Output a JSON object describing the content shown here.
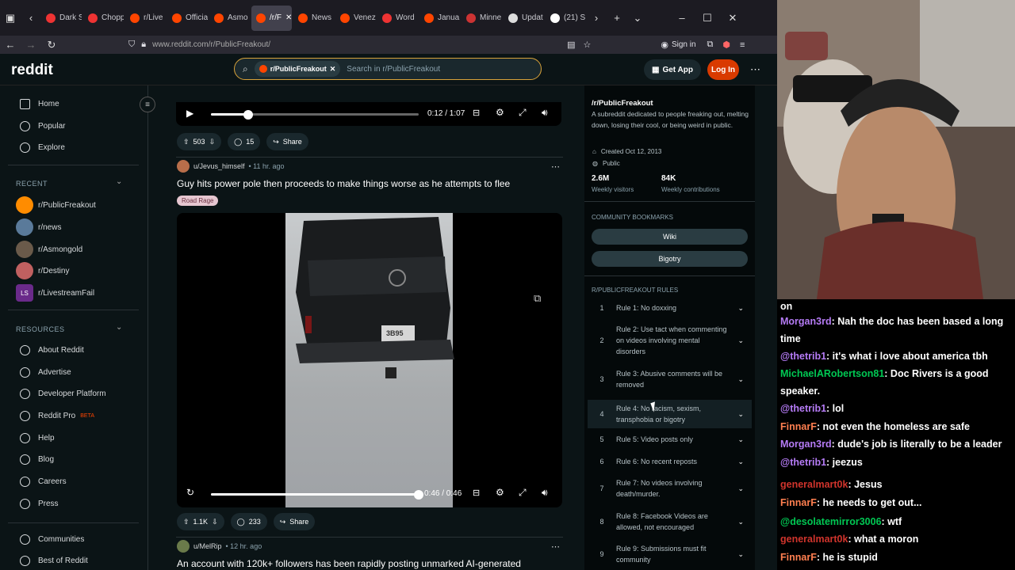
{
  "browser": {
    "tabs": [
      "Dark S",
      "Chopp",
      "r/Live",
      "Officia",
      "Asmo",
      "/r/F",
      "News",
      "Venez",
      "Word",
      "Janua",
      "Minne",
      "Updat",
      "(21) S"
    ],
    "url": "www.reddit.com/r/PublicFreakout/",
    "signin": "Sign in"
  },
  "header": {
    "logo": "reddit",
    "chip": "r/PublicFreakout",
    "search_placeholder": "Search in r/PublicFreakout",
    "get_app": "Get App",
    "login": "Log In"
  },
  "leftnav": {
    "items": [
      "Home",
      "Popular",
      "Explore"
    ],
    "recent_label": "RECENT",
    "recent": [
      "r/PublicFreakout",
      "r/news",
      "r/Asmongold",
      "r/Destiny",
      "r/LivestreamFail"
    ],
    "resources_label": "RESOURCES",
    "resources": [
      "About Reddit",
      "Advertise",
      "Developer Platform",
      "Reddit Pro",
      "Help",
      "Blog",
      "Careers",
      "Press"
    ],
    "beta": "BETA",
    "bottom": [
      "Communities",
      "Best of Reddit"
    ]
  },
  "feed": {
    "video1": {
      "time": "0:12 / 1:07",
      "progress": 0.18
    },
    "post1_actions": {
      "votes": "503",
      "comments": "15",
      "share": "Share"
    },
    "post2": {
      "author": "u/Jevus_himself",
      "age": "• 11 hr. ago",
      "title": "Guy hits power pole then proceeds to make things worse as he attempts to flee",
      "flair": "Road Rage",
      "time": "0:46 / 0:46",
      "progress": 1.0,
      "votes": "1.1K",
      "comments": "233",
      "share": "Share",
      "plate": "3B95"
    },
    "post3": {
      "author": "u/MelRip",
      "age": "• 12 hr. ago",
      "title": "An account with 120k+ followers has been rapidly posting unmarked AI-generated"
    }
  },
  "sidebar": {
    "name": "/r/PublicFreakout",
    "desc": "A subreddit dedicated to people freaking out, melting down, losing their cool, or being weird in public.",
    "created": "Created Oct 12, 2013",
    "visibility": "Public",
    "stats": [
      {
        "value": "2.6M",
        "label": "Weekly visitors"
      },
      {
        "value": "84K",
        "label": "Weekly contributions"
      }
    ],
    "bookmarks_label": "COMMUNITY BOOKMARKS",
    "bookmarks": [
      "Wiki",
      "Bigotry"
    ],
    "rules_label": "R/PUBLICFREAKOUT RULES",
    "rules": [
      {
        "n": "1",
        "t": "Rule 1: No doxxing"
      },
      {
        "n": "2",
        "t": "Rule 2: Use tact when commenting on videos involving mental disorders"
      },
      {
        "n": "3",
        "t": "Rule 3: Abusive comments will be removed"
      },
      {
        "n": "4",
        "t": "Rule 4: No racism, sexism, transphobia or bigotry"
      },
      {
        "n": "5",
        "t": "Rule 5: Video posts only"
      },
      {
        "n": "6",
        "t": "Rule 6: No recent reposts"
      },
      {
        "n": "7",
        "t": "Rule 7: No videos involving death/murder."
      },
      {
        "n": "8",
        "t": "Rule 8: Facebook Videos are allowed, not encouraged"
      },
      {
        "n": "9",
        "t": "Rule 9: Submissions must fit community"
      }
    ]
  },
  "chat": {
    "messages": [
      {
        "user": "",
        "text": "on",
        "color": "#ffffff"
      },
      {
        "user": "Morgan3rd",
        "text": ": Nah the doc has been based a long time",
        "color": "#b57bf5"
      },
      {
        "user": "@thetrib1",
        "text": ": it's what i love about america tbh",
        "color": "#b57bf5"
      },
      {
        "user": "MichaelARobertson81",
        "text": ": Doc Rivers is a good speaker.",
        "color": "#00c853"
      },
      {
        "user": "@thetrib1",
        "text": ": lol",
        "color": "#b57bf5"
      },
      {
        "user": "FinnarF",
        "text": ": not even the homeless are safe",
        "color": "#ff7f50"
      },
      {
        "user": "Morgan3rd",
        "text": ": dude's job is literally to be a leader",
        "color": "#b57bf5"
      },
      {
        "user": "@thetrib1",
        "text": ": jeezus",
        "color": "#b57bf5"
      },
      {
        "user": "generalmart0k",
        "text": ": Jesus",
        "color": "#d0342c"
      },
      {
        "user": "FinnarF",
        "text": ": he needs to get out...",
        "color": "#ff7f50"
      },
      {
        "user": "@desolatemirror3006",
        "text": ": wtf",
        "color": "#00c853"
      },
      {
        "user": "generalmart0k",
        "text": ": what a moron",
        "color": "#d0342c"
      },
      {
        "user": "FinnarF",
        "text": ": he is stupid",
        "color": "#ff7f50"
      }
    ]
  }
}
